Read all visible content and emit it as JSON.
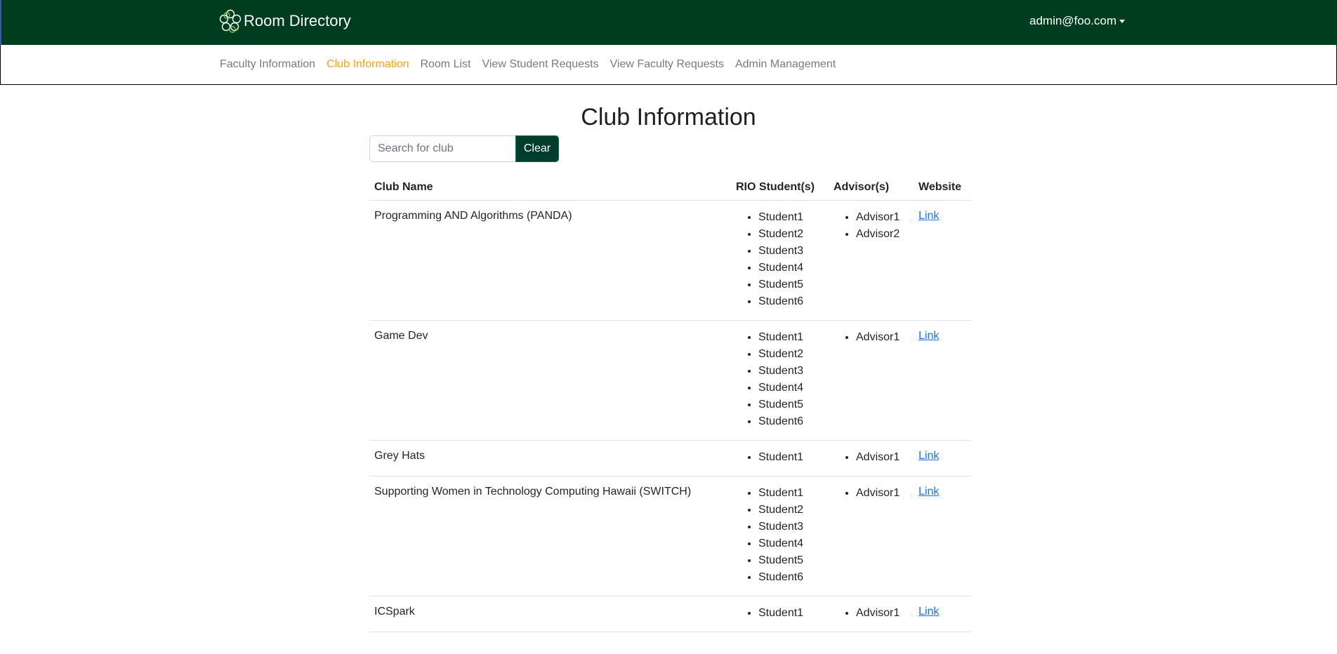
{
  "app": {
    "title": "Room Directory",
    "user": "admin@foo.com"
  },
  "nav": {
    "items": [
      {
        "label": "Faculty Information",
        "active": false
      },
      {
        "label": "Club Information",
        "active": true
      },
      {
        "label": "Room List",
        "active": false
      },
      {
        "label": "View Student Requests",
        "active": false
      },
      {
        "label": "View Faculty Requests",
        "active": false
      },
      {
        "label": "Admin Management",
        "active": false
      }
    ]
  },
  "page": {
    "title": "Club Information"
  },
  "search": {
    "placeholder": "Search for club",
    "value": "",
    "clear_label": "Clear"
  },
  "table": {
    "headers": [
      "Club Name",
      "RIO Student(s)",
      "Advisor(s)",
      "Website"
    ],
    "rows": [
      {
        "name": "Programming AND Algorithms (PANDA)",
        "students": [
          "Student1",
          "Student2",
          "Student3",
          "Student4",
          "Student5",
          "Student6"
        ],
        "advisors": [
          "Advisor1",
          "Advisor2"
        ],
        "website": "Link"
      },
      {
        "name": "Game Dev",
        "students": [
          "Student1",
          "Student2",
          "Student3",
          "Student4",
          "Student5",
          "Student6"
        ],
        "advisors": [
          "Advisor1"
        ],
        "website": "Link"
      },
      {
        "name": "Grey Hats",
        "students": [
          "Student1"
        ],
        "advisors": [
          "Advisor1"
        ],
        "website": "Link"
      },
      {
        "name": "Supporting Women in Technology Computing Hawaii (SWITCH)",
        "students": [
          "Student1",
          "Student2",
          "Student3",
          "Student4",
          "Student5",
          "Student6"
        ],
        "advisors": [
          "Advisor1"
        ],
        "website": "Link"
      },
      {
        "name": "ICSpark",
        "students": [
          "Student1"
        ],
        "advisors": [
          "Advisor1"
        ],
        "website": "Link"
      }
    ]
  },
  "colors": {
    "header_bg": "#003d1e",
    "active_nav": "#f7a21b",
    "button_bg": "#003d2b",
    "link": "#1a73e8"
  }
}
